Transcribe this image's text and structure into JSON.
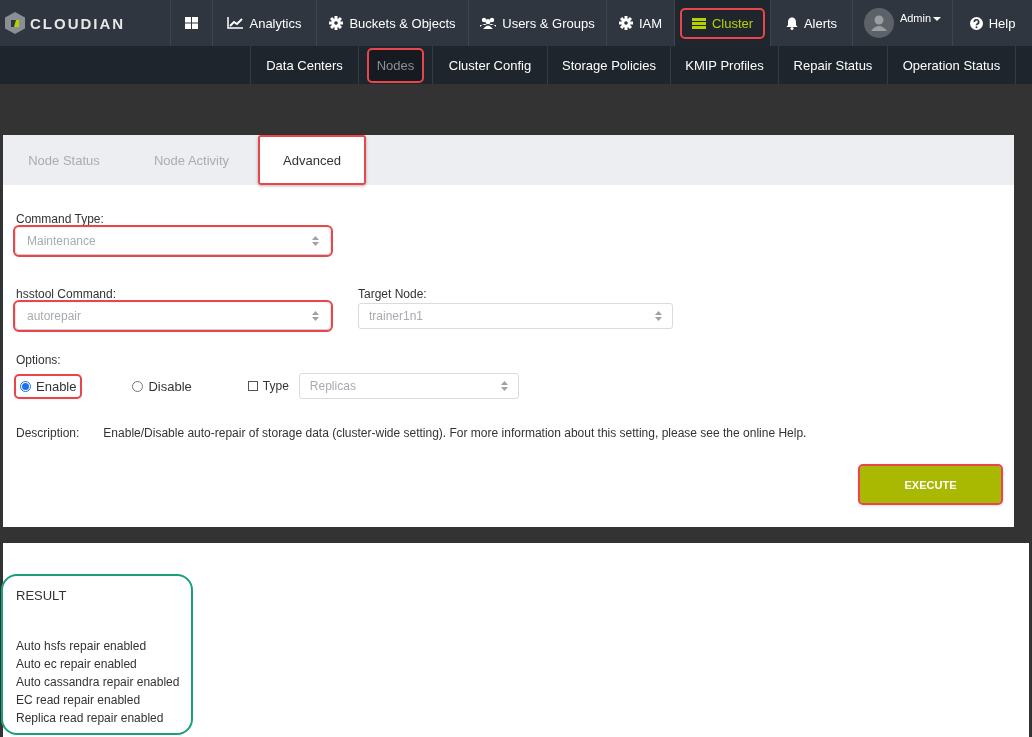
{
  "top_nav": {
    "logo": "CLOUDIAN",
    "items": [
      {
        "kind": "grid",
        "selected": false,
        "highlighted": false
      },
      {
        "kind": "analytics",
        "label": "Analytics",
        "selected": false,
        "highlighted": false
      },
      {
        "kind": "gear",
        "label": "Buckets & Objects",
        "selected": false,
        "highlighted": false
      },
      {
        "kind": "users",
        "label": "Users & Groups",
        "selected": false,
        "highlighted": false
      },
      {
        "kind": "gear",
        "label": "IAM",
        "selected": false,
        "highlighted": false
      },
      {
        "kind": "cluster",
        "label": "Cluster",
        "selected": true,
        "highlighted": true
      },
      {
        "kind": "bell",
        "label": "Alerts",
        "selected": false,
        "highlighted": false
      },
      {
        "kind": "user",
        "label": "Admin",
        "selected": false,
        "highlighted": false
      },
      {
        "kind": "help",
        "label": "Help",
        "selected": false,
        "highlighted": false
      }
    ]
  },
  "sub_nav": {
    "items": [
      {
        "label": "Data Centers",
        "selected": false,
        "highlighted": false
      },
      {
        "label": "Nodes",
        "selected": true,
        "highlighted": true
      },
      {
        "label": "Cluster Config",
        "selected": false,
        "highlighted": false
      },
      {
        "label": "Storage Policies",
        "selected": false,
        "highlighted": false
      },
      {
        "label": "KMIP Profiles",
        "selected": false,
        "highlighted": false
      },
      {
        "label": "Repair Status",
        "selected": false,
        "highlighted": false
      },
      {
        "label": "Operation Status",
        "selected": false,
        "highlighted": false
      }
    ]
  },
  "tabs": [
    {
      "label": "Node Status",
      "selected": false,
      "highlighted": false
    },
    {
      "label": "Node Activity",
      "selected": false,
      "highlighted": false
    },
    {
      "label": "Advanced",
      "selected": true,
      "highlighted": true
    }
  ],
  "form": {
    "command_type": {
      "label": "Command Type:",
      "value": "Maintenance",
      "highlighted": true
    },
    "hsstool_command": {
      "label": "hsstool Command:",
      "value": "autorepair",
      "highlighted": true
    },
    "target_node": {
      "label": "Target Node:",
      "value": "trainer1n1",
      "highlighted": false
    },
    "options": {
      "label": "Options:",
      "radios": [
        {
          "label": "Enable",
          "selected": true,
          "highlighted": true
        },
        {
          "label": "Disable",
          "selected": false,
          "highlighted": false
        }
      ],
      "type_checkbox": {
        "label": "Type",
        "checked": false
      },
      "type_select": {
        "value": "Replicas"
      }
    },
    "description": {
      "label": "Description:",
      "text": "Enable/Disable auto-repair of storage data (cluster-wide setting). For more information about this setting, please see the online Help."
    },
    "execute_button": {
      "label": "EXECUTE",
      "highlighted": true
    }
  },
  "result": {
    "title": "RESULT",
    "highlighted": true,
    "lines": [
      "Auto hsfs repair enabled",
      "Auto ec repair enabled",
      "Auto cassandra repair enabled",
      "EC read repair enabled",
      "Replica read repair enabled"
    ]
  }
}
